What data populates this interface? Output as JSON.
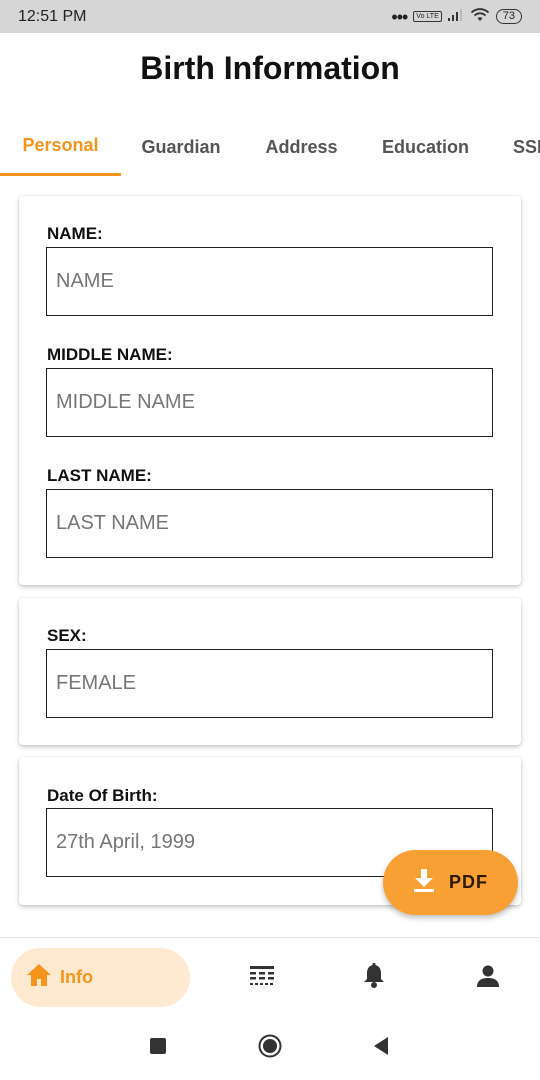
{
  "status_bar": {
    "time": "12:51 PM",
    "dots": "•••",
    "volte": "Vo LTE",
    "battery": "73"
  },
  "page": {
    "title": "Birth Information"
  },
  "tabs": [
    {
      "label": "Personal",
      "active": true
    },
    {
      "label": "Guardian",
      "active": false
    },
    {
      "label": "Address",
      "active": false
    },
    {
      "label": "Education",
      "active": false
    },
    {
      "label": "SSI",
      "active": false
    }
  ],
  "form": {
    "name": {
      "label": "NAME:",
      "value": "",
      "placeholder": "NAME"
    },
    "middle_name": {
      "label": "MIDDLE NAME:",
      "value": "",
      "placeholder": "MIDDLE NAME"
    },
    "last_name": {
      "label": "LAST NAME:",
      "value": "",
      "placeholder": "LAST NAME"
    },
    "sex": {
      "label": "SEX:",
      "value": "",
      "placeholder": "FEMALE"
    },
    "dob": {
      "label": "Date Of Birth:",
      "value": "",
      "placeholder": "27th April, 1999"
    }
  },
  "fab": {
    "label": "PDF",
    "icon": "download-icon"
  },
  "bottom_nav": {
    "items": [
      {
        "label": "Info",
        "icon": "home-icon",
        "active": true
      },
      {
        "label": "",
        "icon": "table-icon",
        "active": false
      },
      {
        "label": "",
        "icon": "bell-icon",
        "active": false
      },
      {
        "label": "",
        "icon": "person-icon",
        "active": false
      }
    ]
  },
  "colors": {
    "accent": "#f7941d",
    "accent_light": "#ffe9d1",
    "status_bar": "#d6d6d6"
  }
}
